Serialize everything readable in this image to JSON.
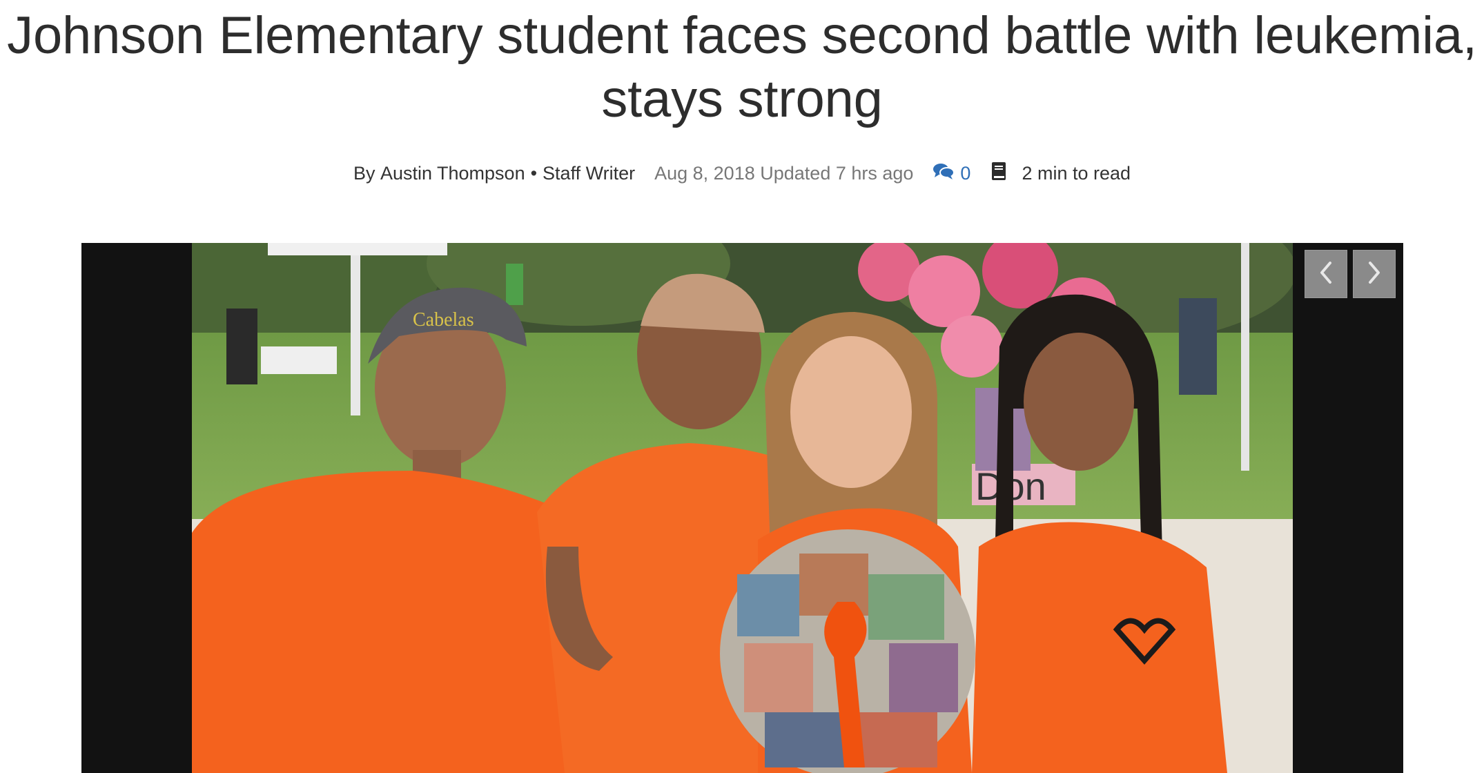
{
  "article": {
    "headline": "Johnson Elementary student faces second battle with leukemia, stays strong",
    "byline": {
      "prefix": "By",
      "author": "Austin Thompson",
      "separator": "•",
      "role": "Staff Writer",
      "date": "Aug 8, 2018",
      "updated": "Updated 7 hrs ago",
      "comment_count": "0",
      "read_time": "2 min to read"
    }
  },
  "gallery": {
    "prev_icon": "chevron-left-icon",
    "next_icon": "chevron-right-icon",
    "photo_text": {
      "cap_logo": "Cabelas",
      "sign": "Don"
    }
  },
  "colors": {
    "accent_link": "#2f6fb7",
    "shirt_orange": "#f4621e",
    "frame_bg": "#121212",
    "nav_button": "#8a8a8a"
  },
  "icons": [
    "comments-icon",
    "book-icon",
    "chevron-left-icon",
    "chevron-right-icon"
  ]
}
